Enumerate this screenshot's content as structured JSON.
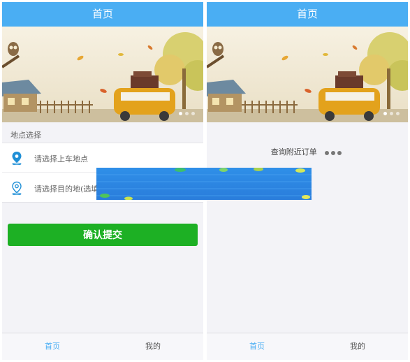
{
  "left_screen": {
    "navbar": {
      "title": "首页"
    },
    "banner": {
      "sign_text": "",
      "slides_count": 3,
      "active_slide": 0
    },
    "location": {
      "section_label": "地点选择",
      "pickup_placeholder": "请选择上车地点",
      "destination_placeholder": "请选择目的地(选填"
    },
    "submit_label": "确认提交",
    "tabs": {
      "home": "首页",
      "mine": "我的"
    }
  },
  "right_screen": {
    "navbar": {
      "title": "首页"
    },
    "loading_text": "查询附近订单",
    "tabs": {
      "home": "首页",
      "mine": "我的"
    }
  },
  "colors": {
    "navbar": "#4aaef3",
    "submit": "#1db024",
    "active_tab": "#4aaef3",
    "location_icon": "#1f8fd6"
  },
  "icons": {
    "pickup": "location-pin-filled-icon",
    "destination": "location-pin-outline-icon"
  }
}
